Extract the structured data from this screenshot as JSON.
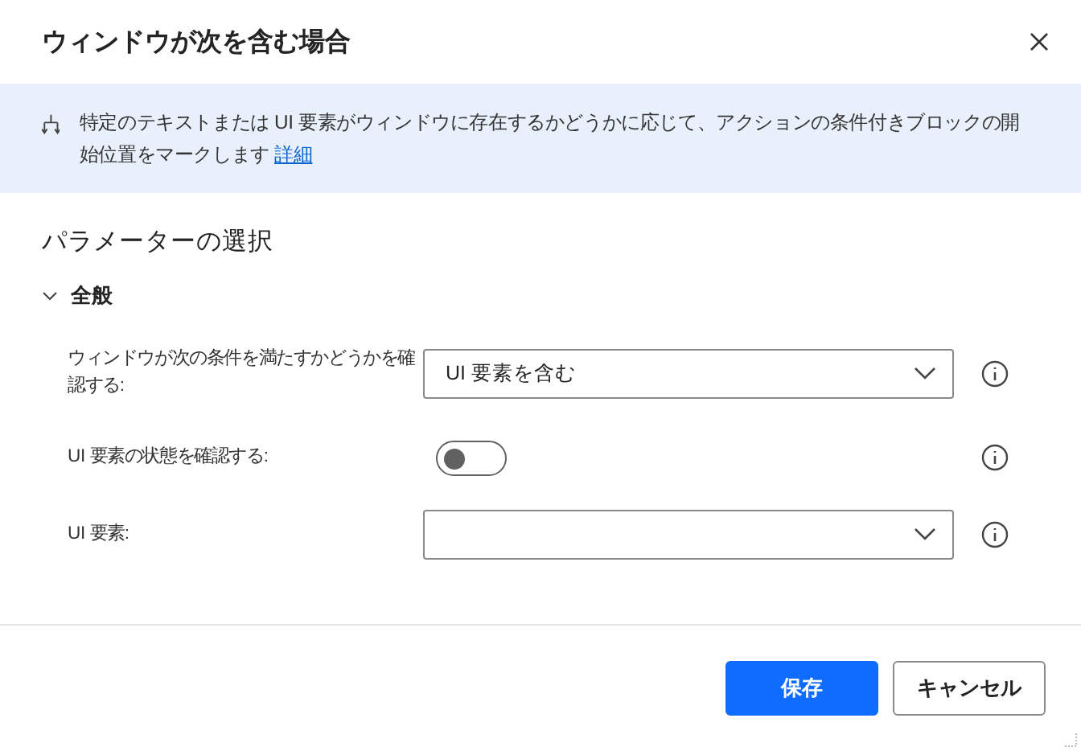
{
  "dialog": {
    "title": "ウィンドウが次を含む場合"
  },
  "info": {
    "text": "特定のテキストまたは UI 要素がウィンドウに存在するかどうかに応じて、アクションの条件付きブロックの開始位置をマークします",
    "link": "詳細"
  },
  "section_title": "パラメーターの選択",
  "group": {
    "label": "全般",
    "expanded": true
  },
  "parameters": [
    {
      "kind": "dropdown",
      "label": "ウィンドウが次の条件を満たすかどうかを確認する:",
      "value": "UI 要素を含む"
    },
    {
      "kind": "toggle",
      "label": "UI 要素の状態を確認する:",
      "on": false
    },
    {
      "kind": "dropdown",
      "label": "UI 要素:"
    }
  ],
  "buttons": [
    {
      "label": "保存",
      "primary": true
    },
    {
      "label": "キャンセル",
      "primary": false
    }
  ]
}
